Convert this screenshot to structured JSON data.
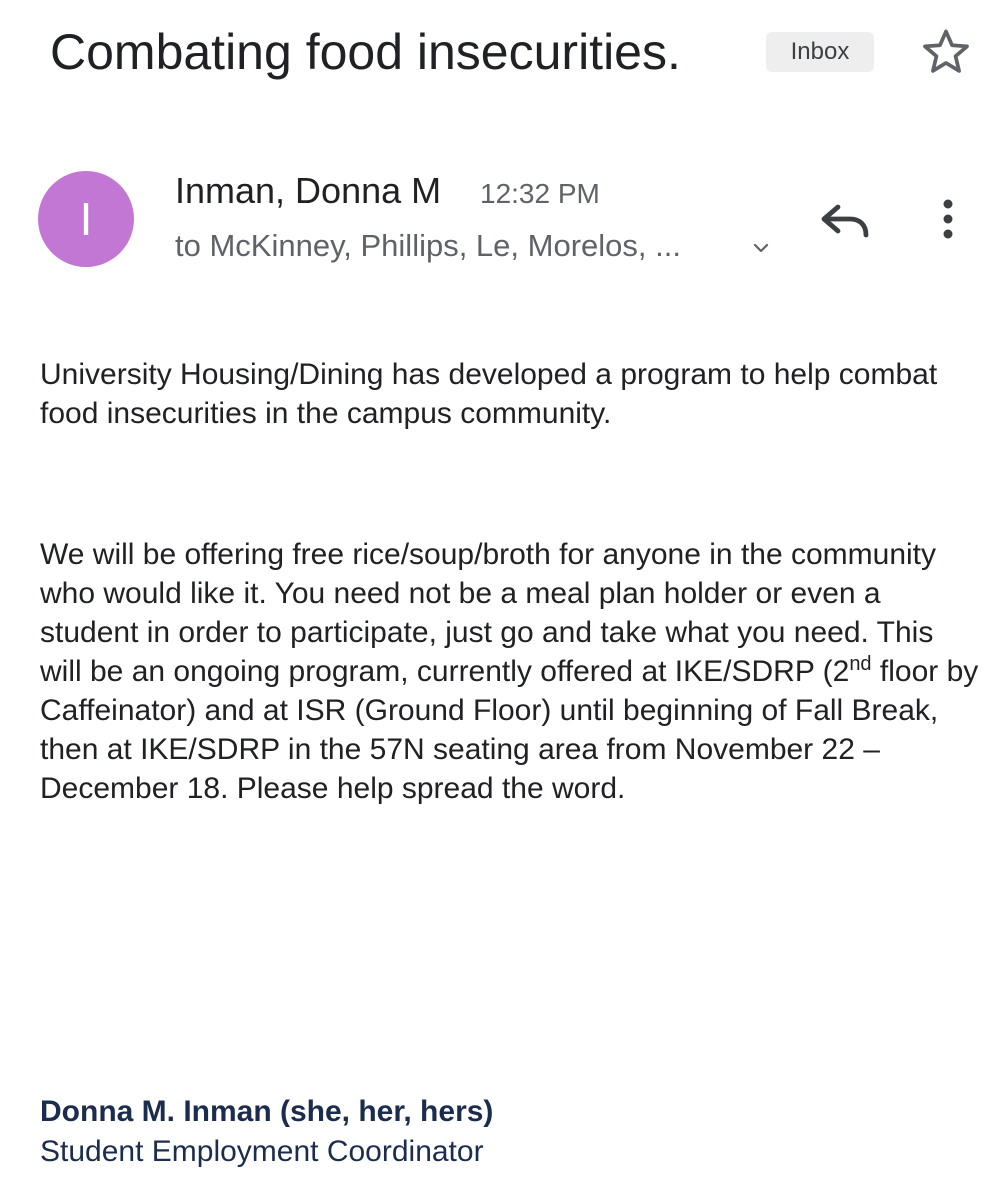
{
  "subject": {
    "title": "Combating food insecurities.",
    "label": "Inbox",
    "star_icon": "star-outline-icon"
  },
  "message": {
    "avatar_letter": "I",
    "avatar_color": "#c177d3",
    "sender": "Inman, Donna M",
    "time": "12:32 PM",
    "recipients": "to McKinney, Phillips, Le, Morelos, ...",
    "icons": {
      "expand": "chevron-down-icon",
      "reply": "reply-icon",
      "more": "more-vert-icon"
    }
  },
  "body": {
    "p1": "University Housing/Dining has developed a program to help combat food insecurities in the campus community.",
    "p2_before_sup": "We will be offering free rice/soup/broth for anyone in the community who would like it. You need not be a meal plan holder or even a student in order to participate, just go and take what you need.  This will be an ongoing program, currently offered at IKE/SDRP (2",
    "p2_sup": "nd",
    "p2_after_sup": " floor by Caffeinator) and at ISR (Ground Floor) until beginning of Fall Break, then at IKE/SDRP in the 57N seating area from November 22 – December 18. Please help spread the word."
  },
  "signature": {
    "name": "Donna M. Inman (she, her, hers)",
    "title": "Student Employment Coordinator"
  }
}
